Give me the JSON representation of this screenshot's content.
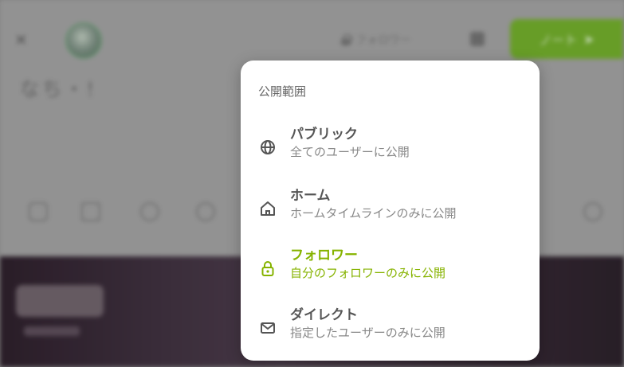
{
  "composer": {
    "visibility_button_label": "フォロワー",
    "post_button_label": "ノート",
    "draft_text": "なち・!"
  },
  "visibility_popup": {
    "title": "公開範囲",
    "accent_color": "#86b300",
    "selected": "followers",
    "options": [
      {
        "id": "public",
        "icon": "globe-icon",
        "label": "パブリック",
        "description": "全てのユーザーに公開"
      },
      {
        "id": "home",
        "icon": "home-icon",
        "label": "ホーム",
        "description": "ホームタイムラインのみに公開"
      },
      {
        "id": "followers",
        "icon": "lock-icon",
        "label": "フォロワー",
        "description": "自分のフォロワーのみに公開"
      },
      {
        "id": "specified",
        "icon": "mail-icon",
        "label": "ダイレクト",
        "description": "指定したユーザーのみに公開"
      }
    ]
  }
}
